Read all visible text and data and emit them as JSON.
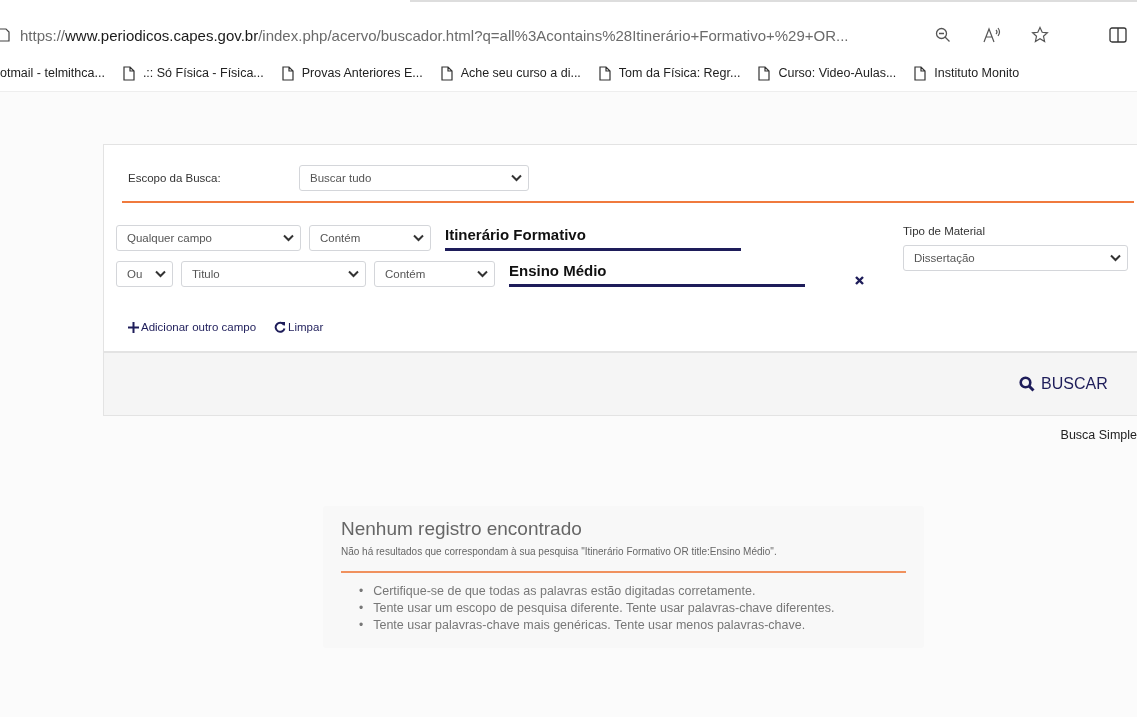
{
  "browser": {
    "url": "https://**www.periodicos.capes.gov.br**/index.php/acervo/buscador.html?q=all%3Acontains%28Itinerário+Formativo+%29+OR...",
    "bookmarks": [
      {
        "label": "otmail - telmithca...",
        "icon": false
      },
      {
        "label": ".:: Só Física - Física...",
        "icon": true
      },
      {
        "label": "Provas Anteriores E...",
        "icon": true
      },
      {
        "label": "Ache seu curso a di...",
        "icon": true
      },
      {
        "label": "Tom da Física: Regr...",
        "icon": true
      },
      {
        "label": "Curso: Video-Aulas...",
        "icon": true
      },
      {
        "label": "Instituto Monito",
        "icon": true
      }
    ]
  },
  "search_form": {
    "scope_label": "Escopo da Busca:",
    "scope_value": "Buscar tudo",
    "criteria": [
      {
        "field": "Qualquer campo",
        "match": "Contém",
        "value": "Itinerário Formativo",
        "removable": false
      },
      {
        "operator": "Ou",
        "field": "Titulo",
        "match": "Contém",
        "value": "Ensino Médio",
        "removable": true
      }
    ],
    "material_label": "Tipo de Material",
    "material_value": "Dissertação",
    "add_field": "Adicionar outro campo",
    "clear": "Limpar",
    "search_button": "BUSCAR"
  },
  "simple_search_link": "Busca Simple",
  "results": {
    "title": "Nenhum registro encontrado",
    "message": "Não há resultados que correspondam à sua pesquisa \"Itinerário Formativo OR title:Ensino Médio\".",
    "tips": [
      {
        "bullet": "•",
        "text": "Certifique-se de que todas as palavras estão digitadas corretamente."
      },
      {
        "bullet": "•",
        "text": "Tente usar um escopo de pesquisa diferente. Tente usar palavras-chave diferentes."
      },
      {
        "bullet": "•",
        "text": "Tente usar palavras-chave mais genéricas. Tente usar menos palavras-chave."
      }
    ]
  }
}
